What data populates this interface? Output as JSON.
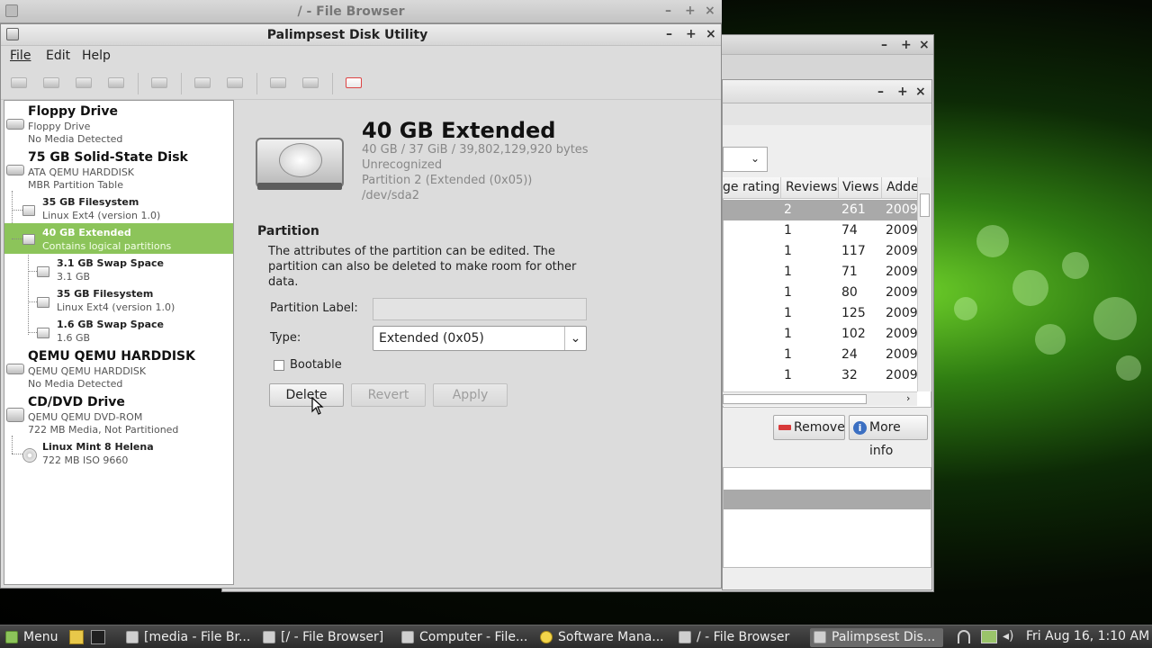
{
  "file_browser_title": "/ - File Browser",
  "window": {
    "title": "Palimpsest Disk Utility",
    "menu": [
      "File",
      "Edit",
      "Help"
    ]
  },
  "tree": {
    "floppy": {
      "title": "Floppy Drive",
      "sub1": "Floppy Drive",
      "sub2": "No Media Detected"
    },
    "ssd": {
      "title": "75 GB Solid-State Disk",
      "sub1": "ATA QEMU HARDDISK",
      "sub2": "MBR Partition Table"
    },
    "fs35a": {
      "title": "35 GB Filesystem",
      "sub": "Linux Ext4 (version 1.0)"
    },
    "ext40": {
      "title": "40 GB Extended",
      "sub": "Contains logical partitions"
    },
    "swap31": {
      "title": "3.1 GB Swap Space",
      "sub": "3.1 GB"
    },
    "fs35b": {
      "title": "35 GB Filesystem",
      "sub": "Linux Ext4 (version 1.0)"
    },
    "swap16": {
      "title": "1.6 GB Swap Space",
      "sub": "1.6 GB"
    },
    "qemu": {
      "title": "QEMU QEMU HARDDISK",
      "sub1": "QEMU QEMU HARDDISK",
      "sub2": "No Media Detected"
    },
    "cdrom": {
      "title": "CD/DVD Drive",
      "sub1": "QEMU QEMU DVD-ROM",
      "sub2": "722 MB Media, Not Partitioned"
    },
    "mint": {
      "title": "Linux Mint 8 Helena",
      "sub": "722 MB ISO 9660"
    }
  },
  "volume": {
    "title": "40 GB Extended",
    "size": "40 GB / 37 GiB / 39,802,129,920 bytes",
    "usage": "Unrecognized",
    "partition": "Partition 2 (Extended (0x05))",
    "device": "/dev/sda2"
  },
  "partition_section": {
    "heading": "Partition",
    "description": "The attributes of the partition can be edited. The partition can also be deleted to make room for other data.",
    "label_field": "Partition Label:",
    "label_value": "",
    "type_field": "Type:",
    "type_value": "Extended (0x05)",
    "bootable": "Bootable",
    "delete": "Delete",
    "revert": "Revert",
    "apply": "Apply"
  },
  "software_manager": {
    "headers": [
      "ge rating",
      "Reviews",
      "Views",
      "Adde"
    ],
    "rows": [
      [
        "2",
        "261",
        "2009-"
      ],
      [
        "1",
        "74",
        "2009-"
      ],
      [
        "1",
        "117",
        "2009-"
      ],
      [
        "1",
        "71",
        "2009-"
      ],
      [
        "1",
        "80",
        "2009-"
      ],
      [
        "1",
        "125",
        "2009-"
      ],
      [
        "1",
        "102",
        "2009-"
      ],
      [
        "1",
        "24",
        "2009-"
      ],
      [
        "1",
        "32",
        "2009-"
      ]
    ],
    "remove": "Remove",
    "more_info": "More info"
  },
  "taskbar": {
    "menu": "Menu",
    "tasks": [
      "[media - File Br...",
      "[/ - File Browser]",
      "Computer - File...",
      "Software Mana...",
      "/ - File Browser",
      "Palimpsest Dis..."
    ],
    "clock": "Fri Aug 16,  1:10 AM"
  }
}
